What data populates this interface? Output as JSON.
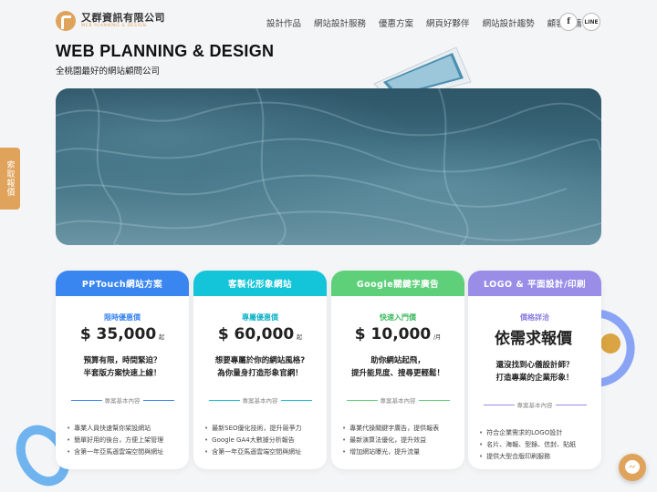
{
  "brand": {
    "name": "又群資訊有限公司",
    "tagline": "WEB PLANNING & DESIGN"
  },
  "nav": [
    "設計作品",
    "網站設計服務",
    "優惠方案",
    "網頁好夥伴",
    "網站設計趨勢",
    "顧客推薦"
  ],
  "social": {
    "facebook": "f",
    "line": "LINE"
  },
  "hero": {
    "title": "WEB PLANNING & DESIGN",
    "subtitle": "全桃園最好的網站顧問公司"
  },
  "side_tab": "索取報價",
  "colors": {
    "accent": "#e0a35b"
  },
  "cards": [
    {
      "head": "PPTouch網站方案",
      "color": "#3a86f0",
      "promo": "限時優惠價",
      "price": "$ 35,000",
      "unit": "起",
      "slogan1": "預算有限，時間緊迫？",
      "slogan2": "半套版方案快速上線！",
      "section": "專案基本內容",
      "features": [
        "專業人員快速幫你架設網站",
        "簡單好用的後台，方便上架管理",
        "含第一年亞馬遜雲端空間與網址"
      ]
    },
    {
      "head": "客製化形象網站",
      "color": "#14c4d8",
      "promo": "專屬優惠價",
      "price": "$ 60,000",
      "unit": "起",
      "slogan1": "想要專屬於你的網站風格?",
      "slogan2": "為你量身打造形象官網！",
      "section": "專案基本內容",
      "features": [
        "最新SEO優化技術，提升競爭力",
        "Google GA4大數據分析報告",
        "含第一年亞馬遜雲端空間與網址"
      ]
    },
    {
      "head": "Google關鍵字廣告",
      "color": "#5ed07a",
      "promo": "快速入門價",
      "price": "$ 10,000",
      "unit": "/月",
      "slogan1": "助你網站起飛，",
      "slogan2": "提升能見度、搜尋更輕鬆！",
      "section": "專案基本內容",
      "features": [
        "專業代操關鍵字廣告，提供報表",
        "最新演算法優化，提升效益",
        "增加網站曝光，提升流量"
      ]
    },
    {
      "head": "LOGO & 平面設計/印刷",
      "color": "#9a8de8",
      "promo": "價格詳洽",
      "price": "依需求報價",
      "unit": "",
      "slogan1": "還沒找到心儀設計師？",
      "slogan2": "打造專業的企業形象！",
      "section": "專案基本內容",
      "features": [
        "符合企業需求的LOGO設計",
        "名片、海報、型錄、信封、貼紙",
        "提供大型合版印刷服務"
      ]
    }
  ]
}
